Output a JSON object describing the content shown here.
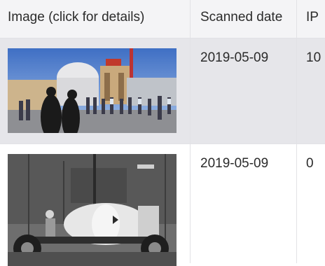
{
  "table": {
    "columns": [
      {
        "label": "Image (click for details)"
      },
      {
        "label": "Scanned date"
      },
      {
        "label": "IP"
      }
    ],
    "rows": [
      {
        "image_icon": "photo-thumbnail-icon",
        "scanned_date": "2019-05-09",
        "ip": "10"
      },
      {
        "image_icon": "photo-thumbnail-icon",
        "scanned_date": "2019-05-09",
        "ip": "0"
      }
    ]
  },
  "colors": {
    "header_bg": "#f4f4f6",
    "selected_row_bg": "#e6e6ea",
    "divider": "#e2e2e6",
    "text": "#2b2b2b"
  }
}
